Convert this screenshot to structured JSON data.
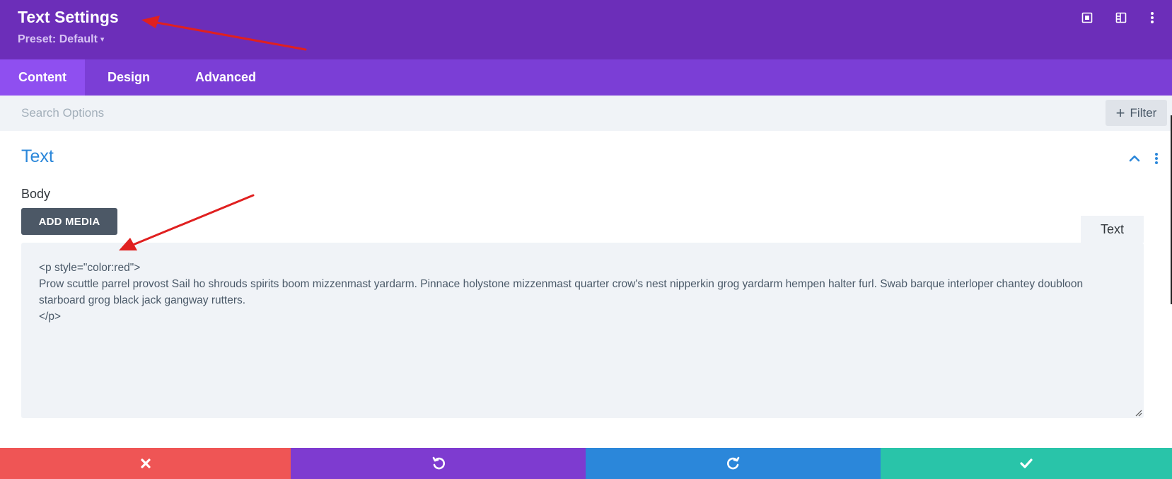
{
  "header": {
    "title": "Text Settings",
    "preset_label": "Preset: Default",
    "caret": "▾",
    "icons": [
      "expand-modal-icon",
      "sidebar-layout-icon",
      "more-options-icon"
    ]
  },
  "tabs": [
    {
      "label": "Content",
      "active": true
    },
    {
      "label": "Design",
      "active": false
    },
    {
      "label": "Advanced",
      "active": false
    }
  ],
  "search": {
    "placeholder": "Search Options",
    "value": "",
    "filter_label": "Filter"
  },
  "section": {
    "title": "Text",
    "field_label": "Body",
    "add_media_label": "ADD MEDIA",
    "editor_mode_tab": "Text",
    "editor_content": "<p style=\"color:red\">\nProw scuttle parrel provost Sail ho shrouds spirits boom mizzenmast yardarm. Pinnace holystone mizzenmast quarter crow's nest nipperkin grog yardarm hempen halter furl. Swab barque interloper chantey doubloon starboard grog black jack gangway rutters.\n</p>"
  },
  "footer": {
    "buttons": [
      "close-icon",
      "undo-icon",
      "redo-icon",
      "checkmark-icon"
    ]
  },
  "colors": {
    "header_bg": "#6c2eb9",
    "tabs_bg": "#7b3ed6",
    "tab_active_bg": "#8f4ff0",
    "accent_blue": "#2b87da",
    "close_red": "#ef5555",
    "save_green": "#29c4a9",
    "annotation_arrow": "#e02020"
  }
}
